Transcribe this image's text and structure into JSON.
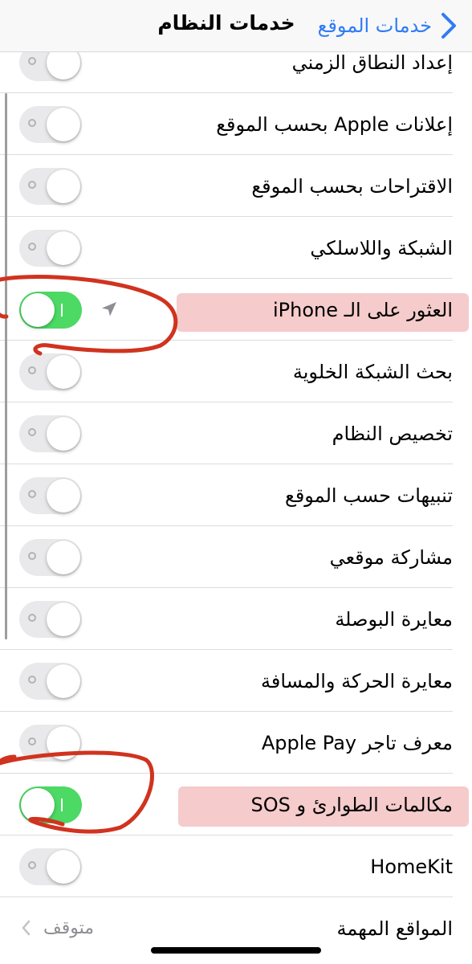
{
  "nav": {
    "title": "خدمات النظام",
    "back_label": "خدمات الموقع"
  },
  "rows": [
    {
      "label": "إعداد النطاق الزمني",
      "toggle": "off"
    },
    {
      "label": "إعلانات Apple بحسب الموقع",
      "toggle": "off"
    },
    {
      "label": "الاقتراحات بحسب الموقع",
      "toggle": "off"
    },
    {
      "label": "الشبكة واللاسلكي",
      "toggle": "off"
    },
    {
      "label": "العثور على الـ iPhone",
      "toggle": "on",
      "location_icon": "location-arrow-icon",
      "highlighted": true
    },
    {
      "label": "بحث الشبكة الخلوية",
      "toggle": "off"
    },
    {
      "label": "تخصيص النظام",
      "toggle": "off"
    },
    {
      "label": "تنبيهات حسب الموقع",
      "toggle": "off"
    },
    {
      "label": "مشاركة موقعي",
      "toggle": "off"
    },
    {
      "label": "معايرة البوصلة",
      "toggle": "off"
    },
    {
      "label": "معايرة الحركة والمسافة",
      "toggle": "off"
    },
    {
      "label": "معرف تاجر Apple Pay",
      "toggle": "off"
    },
    {
      "label": "مكالمات الطوارئ و SOS",
      "toggle": "on",
      "highlighted": true
    },
    {
      "label": "HomeKit",
      "toggle": "off"
    },
    {
      "label": "المواقع المهمة",
      "value": "متوقف"
    }
  ],
  "colors": {
    "accent_blue": "#2f7cf6",
    "switch_on": "#4cd964",
    "switch_off": "#e9e9eb",
    "annotation_red": "#d0331f",
    "highlight": "#e88c8c"
  }
}
